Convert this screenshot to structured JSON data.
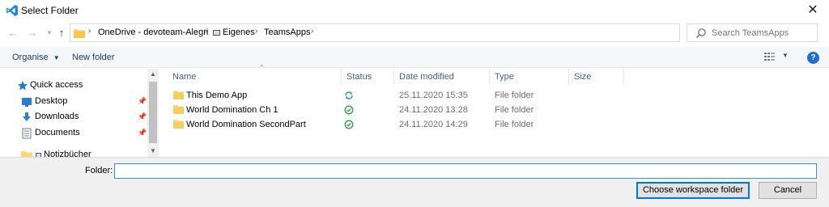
{
  "window": {
    "title": "Select Folder"
  },
  "nav": {
    "breadcrumb": [
      "OneDrive - devoteam-Alegri",
      "Eigenes",
      "TeamsApps"
    ],
    "search_placeholder": "Search TeamsApps"
  },
  "commands": {
    "organise": "Organise",
    "new_folder": "New folder"
  },
  "navpane": {
    "items": [
      {
        "label": "Quick access",
        "icon": "star-icon"
      },
      {
        "label": "Desktop",
        "icon": "desktop-icon"
      },
      {
        "label": "Downloads",
        "icon": "download-icon"
      },
      {
        "label": "Documents",
        "icon": "documents-icon"
      },
      {
        "label": "Notizbücher",
        "icon": "folder-icon"
      }
    ]
  },
  "filelist": {
    "columns": [
      "Name",
      "Status",
      "Date modified",
      "Type",
      "Size"
    ],
    "rows": [
      {
        "name": "This Demo App",
        "status": "syncing",
        "date": "25.11.2020 15:35",
        "type": "File folder",
        "size": ""
      },
      {
        "name": "World Domination Ch 1",
        "status": "synced",
        "date": "24.11.2020 13:28",
        "type": "File folder",
        "size": ""
      },
      {
        "name": "World Domination SecondPart",
        "status": "synced",
        "date": "24.11.2020 14:29",
        "type": "File folder",
        "size": ""
      }
    ]
  },
  "footer": {
    "folder_label": "Folder:",
    "folder_value": "",
    "choose_label": "Choose workspace folder",
    "cancel_label": "Cancel"
  },
  "colors": {
    "accent": "#0078d7",
    "folder": "#f8d775",
    "sync": "#1e8bd6",
    "synced": "#2e9e44"
  }
}
